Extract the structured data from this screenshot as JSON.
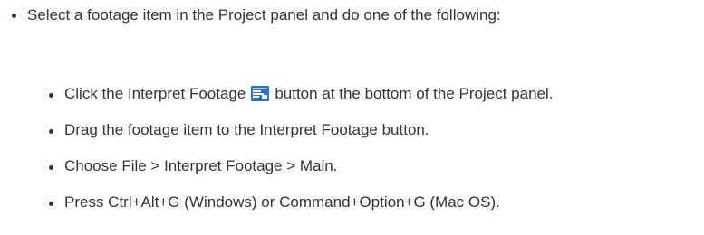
{
  "intro": {
    "text": "Select a footage item in the Project panel and do one of the following:"
  },
  "steps": [
    {
      "before_icon": "Click the Interpret Footage",
      "icon": "interpret-footage-icon",
      "after_icon": "button at the bottom of the Project panel."
    },
    {
      "text": "Drag the footage item to the Interpret Footage button."
    },
    {
      "text": "Choose File > Interpret Footage > Main."
    },
    {
      "text": "Press Ctrl+Alt+G (Windows) or Command+Option+G (Mac OS)."
    }
  ],
  "colors": {
    "text": "#333333",
    "icon_blue": "#2a72c9",
    "icon_light": "#9fc6f0"
  }
}
